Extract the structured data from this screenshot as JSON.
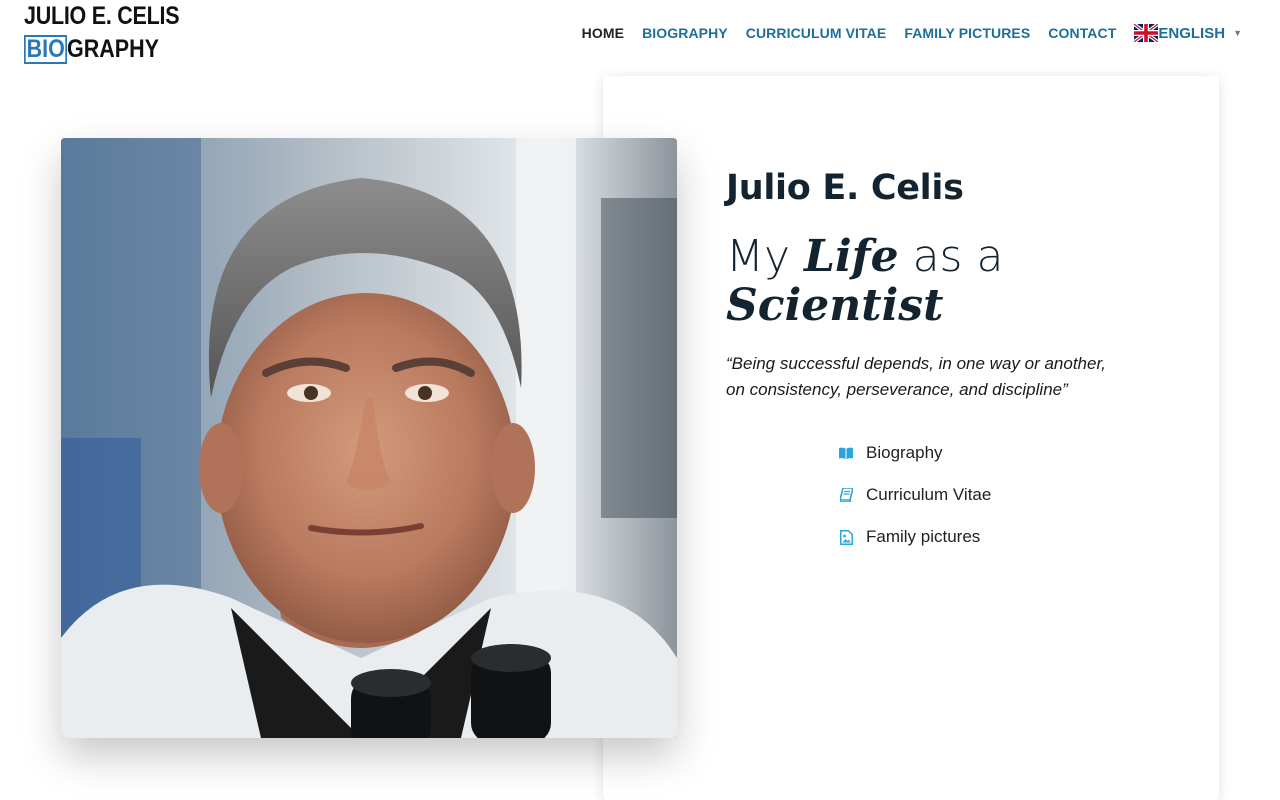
{
  "logo": {
    "line1": "JULIO E. CELIS",
    "bio": "BIO",
    "graphy": "GRAPHY"
  },
  "nav": {
    "items": [
      {
        "label": "HOME",
        "active": true
      },
      {
        "label": "BIOGRAPHY",
        "active": false
      },
      {
        "label": "CURRICULUM VITAE",
        "active": false
      },
      {
        "label": "FAMILY PICTURES",
        "active": false
      },
      {
        "label": "CONTACT",
        "active": false
      }
    ],
    "language": {
      "label": "ENGLISH",
      "caret": "▼",
      "flag_icon": "uk-flag-icon"
    }
  },
  "hero": {
    "name": "Julio E. Celis",
    "headline": {
      "part1": "My ",
      "life": "Life",
      "part2": " as a",
      "scientist": "Scientist"
    },
    "quote": "“Being successful depends, in one way or another, on consistency, perseverance, and discipline”",
    "links": [
      {
        "label": "Biography",
        "icon": "book-open-icon"
      },
      {
        "label": "Curriculum Vitae",
        "icon": "book-icon"
      },
      {
        "label": "Family pictures",
        "icon": "image-file-icon"
      }
    ]
  },
  "colors": {
    "accent": "#1c6f9a",
    "icon": "#29a6dc",
    "logo_blue": "#2b78b8",
    "text_dark": "#132430"
  }
}
